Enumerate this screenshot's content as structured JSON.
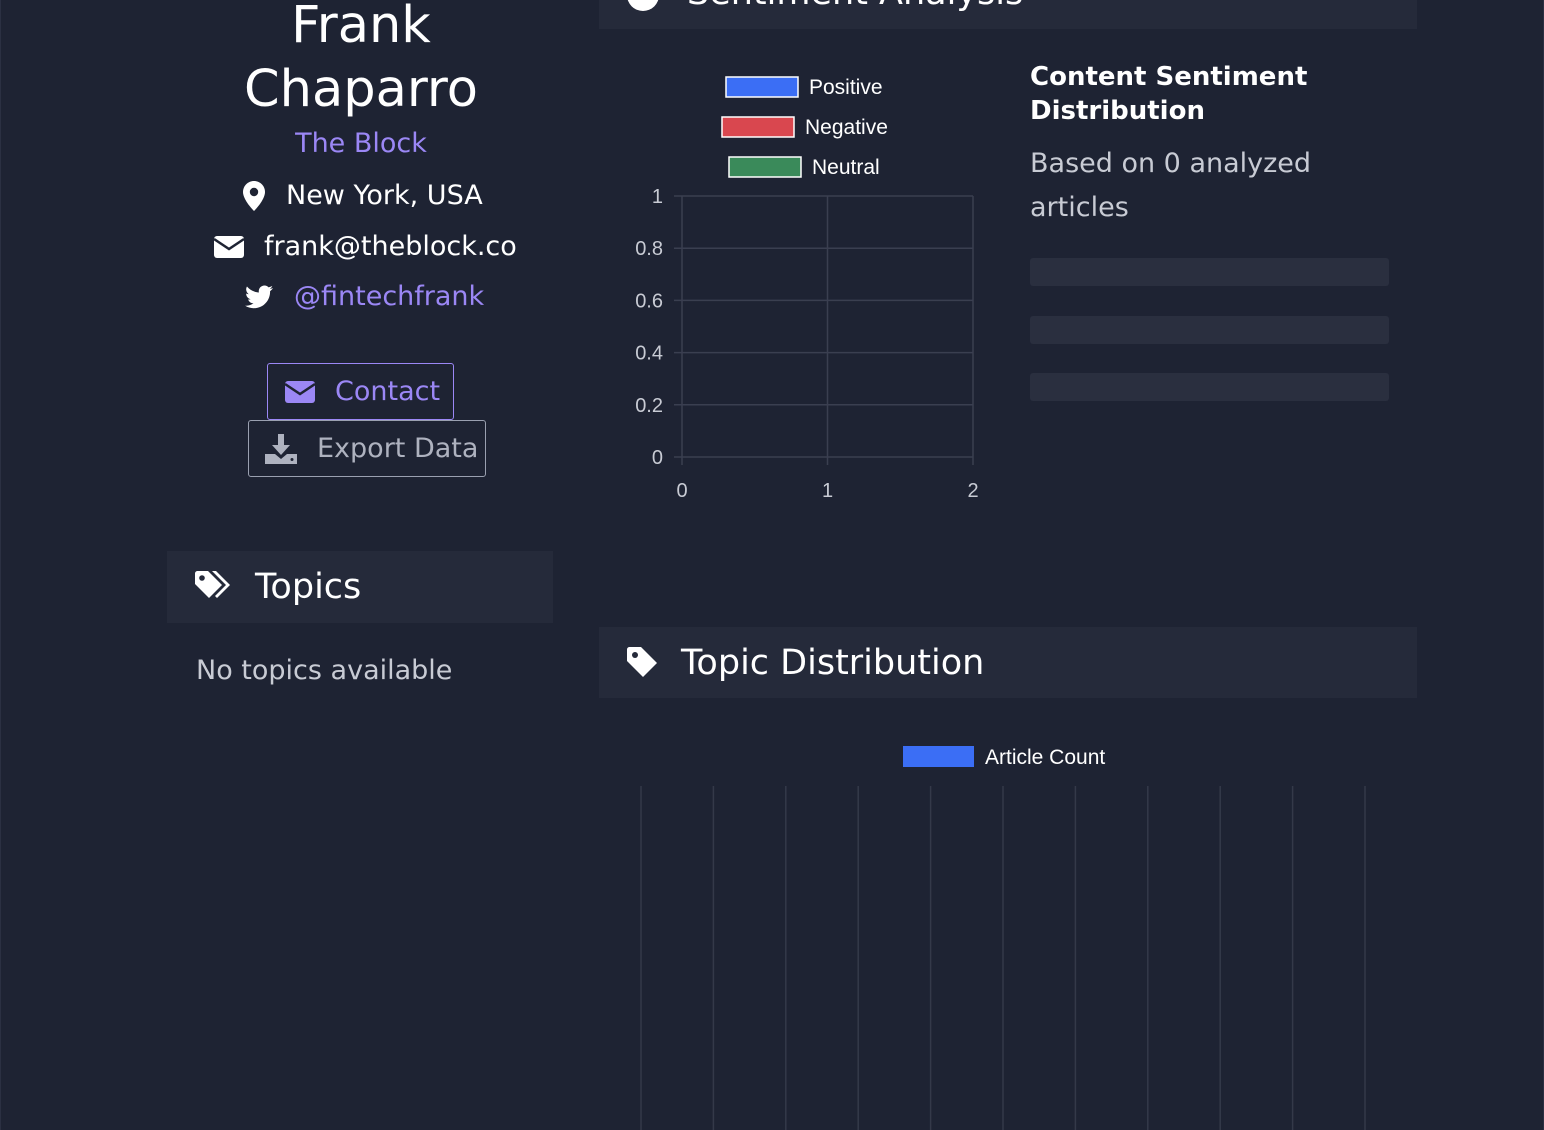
{
  "profile": {
    "name_line1": "Frank",
    "name_line2": "Chaparro",
    "outlet": "The Block",
    "location": "New York, USA",
    "email": "frank@theblock.co",
    "twitter": "@fintechfrank",
    "contact_label": "Contact",
    "export_label": "Export Data"
  },
  "topics": {
    "title": "Topics",
    "empty_text": "No topics available"
  },
  "sentiment": {
    "title": "Sentiment Analysis",
    "summary_title_line1": "Content Sentiment",
    "summary_title_line2": "Distribution",
    "summary_text_line1": "Based on 0 analyzed",
    "summary_text_line2": "articles"
  },
  "topic_distribution": {
    "title": "Topic Distribution"
  },
  "colors": {
    "accent": "#9b87f5",
    "positive": "#3b6ef5",
    "negative": "#d9474f",
    "neutral": "#3a8a5a",
    "article_count": "#3b6ef5"
  },
  "chart_data": [
    {
      "type": "bar",
      "title": "",
      "legend": [
        "Positive",
        "Negative",
        "Neutral"
      ],
      "legend_placement": "top",
      "series": [
        {
          "name": "Positive",
          "values": []
        },
        {
          "name": "Negative",
          "values": []
        },
        {
          "name": "Neutral",
          "values": []
        }
      ],
      "x_ticks": [
        "0",
        "1",
        "2"
      ],
      "y_ticks": [
        "0",
        "0.2",
        "0.4",
        "0.6",
        "0.8",
        "1"
      ],
      "xlim": [
        0,
        2
      ],
      "ylim": [
        0,
        1
      ],
      "grid": true
    },
    {
      "type": "bar",
      "title": "",
      "legend": [
        "Article Count"
      ],
      "legend_placement": "top",
      "series": [
        {
          "name": "Article Count",
          "values": []
        }
      ],
      "categories": [],
      "grid": true
    }
  ]
}
